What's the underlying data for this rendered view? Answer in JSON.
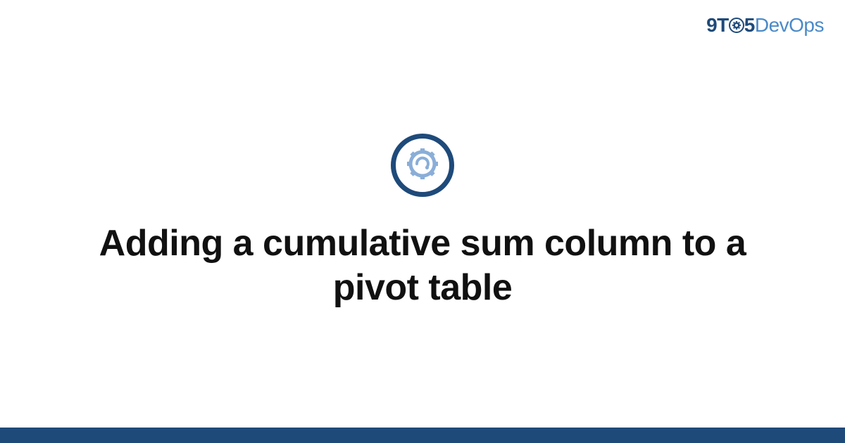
{
  "header": {
    "logo_prefix": "9T",
    "logo_middle": "5",
    "logo_suffix": "DevOps"
  },
  "main": {
    "title": "Adding a cumulative sum column to a pivot table"
  },
  "colors": {
    "brand_dark": "#1e4a7a",
    "brand_light": "#4a8ac9",
    "gear_light": "#8aaed8"
  }
}
